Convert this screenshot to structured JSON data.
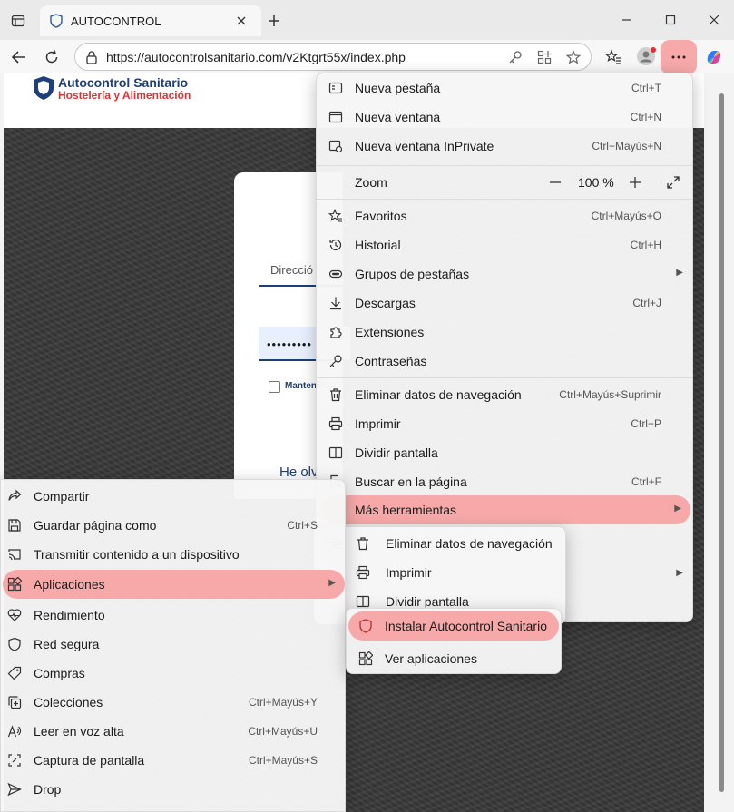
{
  "browser": {
    "tab_title": "AUTOCONTROL",
    "url": "https://autocontrolsanitario.com/v2Ktgrt55x/index.php"
  },
  "site": {
    "logo_line1": "Autocontrol Sanitario",
    "logo_line2": "Hostelería y Alimentación",
    "email_label": "Direcció",
    "password_mask": "•••••••••",
    "keep_label": "Mantene",
    "forgot_label": "He olv"
  },
  "main_menu": {
    "items": [
      {
        "label": "Nueva pestaña",
        "shortcut": "Ctrl+T",
        "icon": "new-tab-icon"
      },
      {
        "label": "Nueva ventana",
        "shortcut": "Ctrl+N",
        "icon": "new-window-icon"
      },
      {
        "label": "Nueva ventana InPrivate",
        "shortcut": "Ctrl+Mayús+N",
        "icon": "inprivate-icon"
      },
      {
        "label": "Favoritos",
        "shortcut": "Ctrl+Mayús+O",
        "icon": "favorites-icon"
      },
      {
        "label": "Historial",
        "shortcut": "Ctrl+H",
        "icon": "history-icon"
      },
      {
        "label": "Grupos de pestañas",
        "shortcut": "",
        "icon": "tab-groups-icon"
      },
      {
        "label": "Descargas",
        "shortcut": "Ctrl+J",
        "icon": "download-icon"
      },
      {
        "label": "Extensiones",
        "shortcut": "",
        "icon": "extensions-icon"
      },
      {
        "label": "Contraseñas",
        "shortcut": "",
        "icon": "key-icon"
      },
      {
        "label": "Eliminar datos de navegación",
        "shortcut": "Ctrl+Mayús+Suprimir",
        "icon": "trash-icon"
      },
      {
        "label": "Imprimir",
        "shortcut": "Ctrl+P",
        "icon": "print-icon"
      },
      {
        "label": "Dividir pantalla",
        "shortcut": "",
        "icon": "split-screen-icon"
      },
      {
        "label": "Buscar en la página",
        "shortcut": "Ctrl+F",
        "icon": "find-icon"
      },
      {
        "label": "Más herramientas",
        "shortcut": "",
        "icon": ""
      }
    ],
    "zoom_label": "Zoom",
    "zoom_value": "100 %"
  },
  "tools_menu": {
    "items": [
      {
        "label": "Eliminar datos de navegación"
      },
      {
        "label": "Imprimir"
      },
      {
        "label": "Dividir pantalla"
      }
    ]
  },
  "apps_menu": {
    "items": [
      {
        "label": "Compartir",
        "shortcut": "",
        "icon": "share-icon"
      },
      {
        "label": "Guardar página como",
        "shortcut": "Ctrl+S",
        "icon": "save-icon"
      },
      {
        "label": "Transmitir contenido a un dispositivo",
        "shortcut": "",
        "icon": "cast-icon"
      },
      {
        "label": "Aplicaciones",
        "shortcut": "",
        "icon": "apps-icon"
      },
      {
        "label": "Rendimiento",
        "shortcut": "",
        "icon": "performance-icon"
      },
      {
        "label": "Red segura",
        "shortcut": "",
        "icon": "secure-network-icon"
      },
      {
        "label": "Compras",
        "shortcut": "",
        "icon": "shopping-tag-icon"
      },
      {
        "label": "Colecciones",
        "shortcut": "Ctrl+Mayús+Y",
        "icon": "collections-icon"
      },
      {
        "label": "Leer en voz alta",
        "shortcut": "Ctrl+Mayús+U",
        "icon": "read-aloud-icon"
      },
      {
        "label": "Captura de pantalla",
        "shortcut": "Ctrl+Mayús+S",
        "icon": "screenshot-icon"
      },
      {
        "label": "Drop",
        "shortcut": "",
        "icon": "drop-icon"
      }
    ]
  },
  "install_menu": {
    "items": [
      {
        "label": "Instalar Autocontrol Sanitario",
        "icon": "site-shield-icon"
      },
      {
        "label": "Ver aplicaciones",
        "icon": "view-apps-icon"
      }
    ]
  },
  "colors": {
    "highlight": "#f7a9a9",
    "brand_blue": "#1d3f7b",
    "brand_red": "#d33333"
  }
}
